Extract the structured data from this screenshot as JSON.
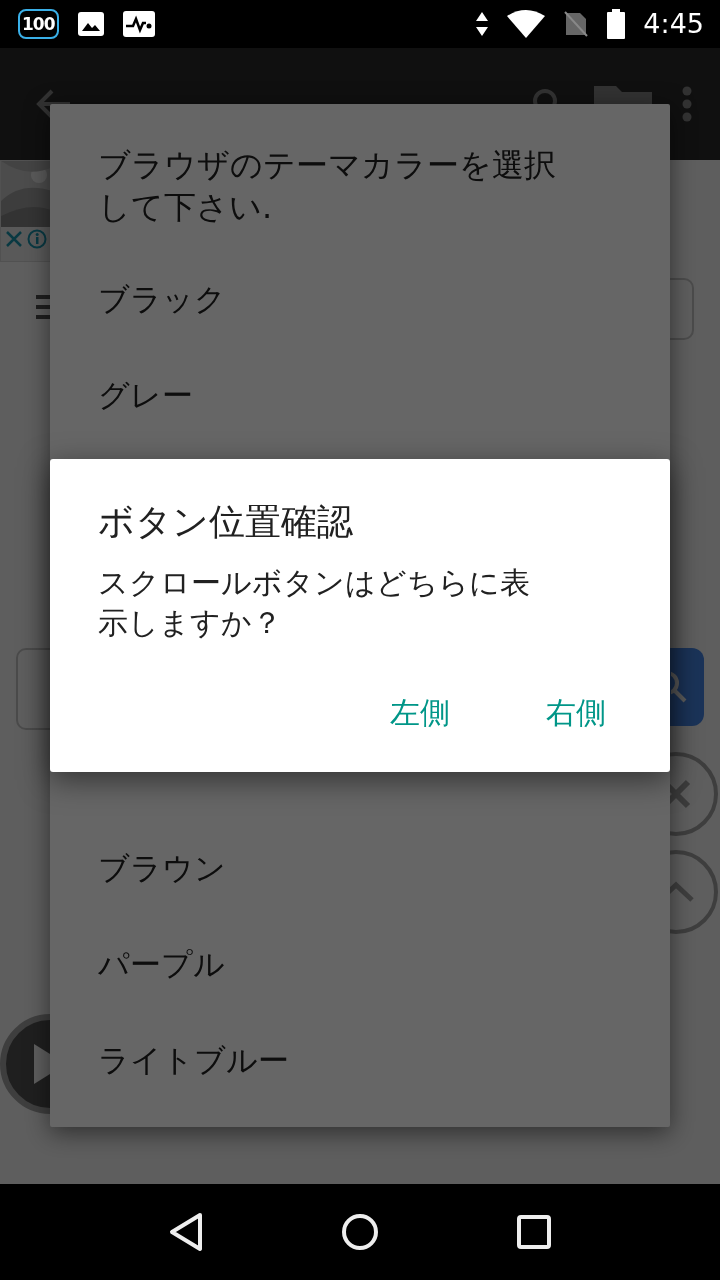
{
  "status_bar": {
    "badge": "100",
    "time": "4:45"
  },
  "theme_dialog": {
    "title": "ブラウザのテーマカラーを選択して下さい.",
    "items_top": [
      "ブラック",
      "グレー"
    ],
    "items_bottom": [
      "ブラウン",
      "パープル",
      "ライトブルー"
    ]
  },
  "confirm_dialog": {
    "title": "ボタン位置確認",
    "message": "スクロールボタンはどちらに表示しますか？",
    "buttons": [
      "左側",
      "右側"
    ]
  }
}
